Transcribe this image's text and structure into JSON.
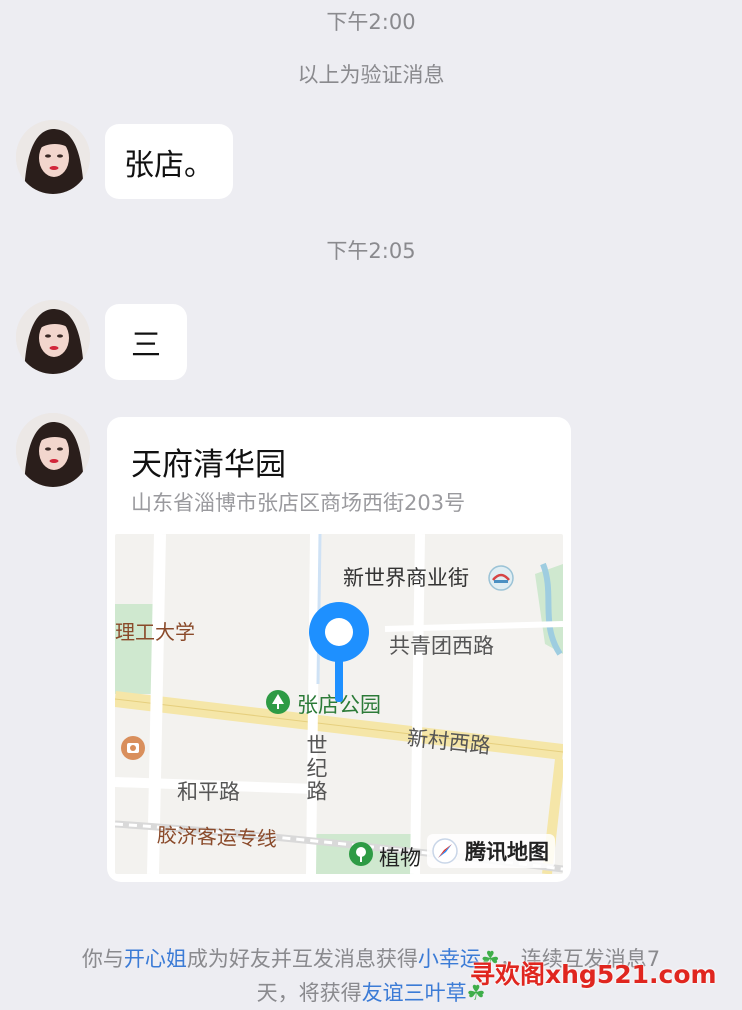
{
  "messages": {
    "ts1": "下午2:00",
    "system_verify": "以上为验证消息",
    "msg1": "张店。",
    "ts2": "下午2:05",
    "msg2": "三"
  },
  "location": {
    "title": "天府清华园",
    "address": "山东省淄博市张店区商场西街203号",
    "map_labels": {
      "xinshijie": "新世界商业街",
      "ligong": "理工大学",
      "gongqing": "共青团西路",
      "park": "张店公园",
      "xincun": "新村西路",
      "shiji": "世纪路",
      "heping": "和平路",
      "jiaoji": "胶济客运专线",
      "zhiwu": "植物"
    },
    "provider": "腾讯地图"
  },
  "footer": {
    "part1": "你与",
    "friend": "开心姐",
    "part2": "成为好友并互发消息获得",
    "badge1": "小幸运",
    "part3": "，连续互发消息7",
    "part4": "天，将获得",
    "badge2": "友谊三叶草"
  },
  "watermark": "寻欢阁xhg521.com",
  "colors": {
    "background": "#ededf2",
    "bubble": "#ffffff",
    "link": "#3b7bd6",
    "pin": "#1e90ff",
    "watermark": "#e0261f"
  }
}
